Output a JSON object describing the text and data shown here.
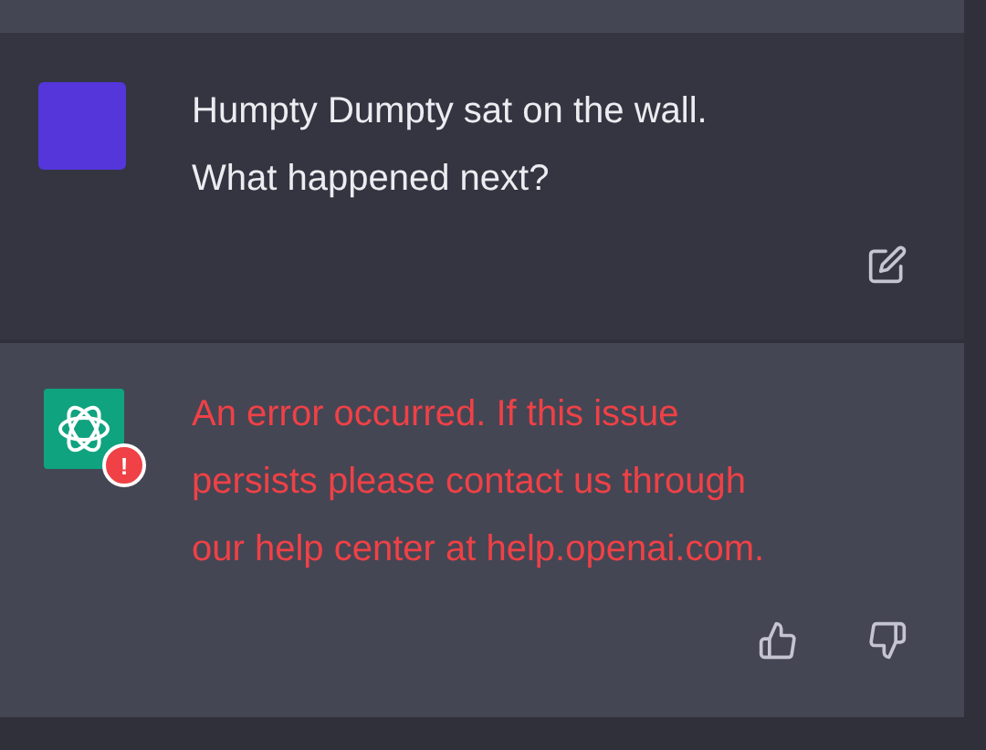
{
  "messages": [
    {
      "kind": "user",
      "text": "Humpty Dumpty sat on the wall. What happened next?",
      "error": false,
      "actions": [
        {
          "kind": "edit"
        }
      ]
    },
    {
      "kind": "assistant",
      "text": "An error occurred. If this issue persists please contact us through our help center at help.openai.com.",
      "error": true,
      "badge": "!",
      "actions": [
        {
          "kind": "thumbs-up"
        },
        {
          "kind": "thumbs-down"
        }
      ]
    }
  ]
}
